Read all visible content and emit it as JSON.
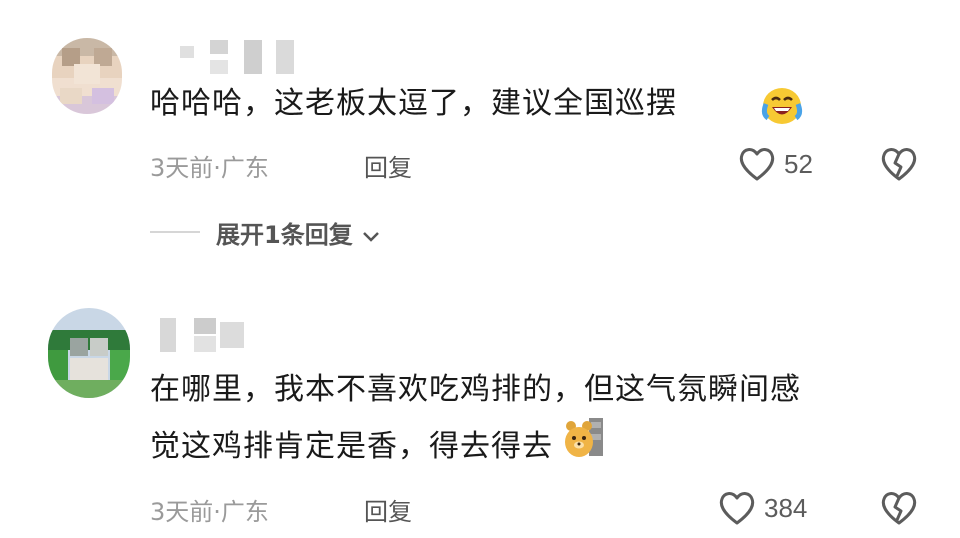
{
  "comments": [
    {
      "text": "哈哈哈，这老板太逗了，建议全国巡摆",
      "emoji_icon": "laughing-crying-face-icon",
      "time_location": "3天前·广东",
      "reply_label": "回复",
      "like_count": "52",
      "expand_replies_label": "展开1条回复"
    },
    {
      "text_line1": "在哪里，我本不喜欢吃鸡排的，但这气氛瞬间感",
      "text_line2": "觉这鸡排肯定是香，得去得去",
      "emoji_icon": "bear-peeking-icon",
      "time_location": "3天前·广东",
      "reply_label": "回复",
      "like_count": "384"
    }
  ],
  "colors": {
    "text": "#1a1a1a",
    "meta": "#9a9a9a",
    "icon": "#5c5c5c"
  }
}
